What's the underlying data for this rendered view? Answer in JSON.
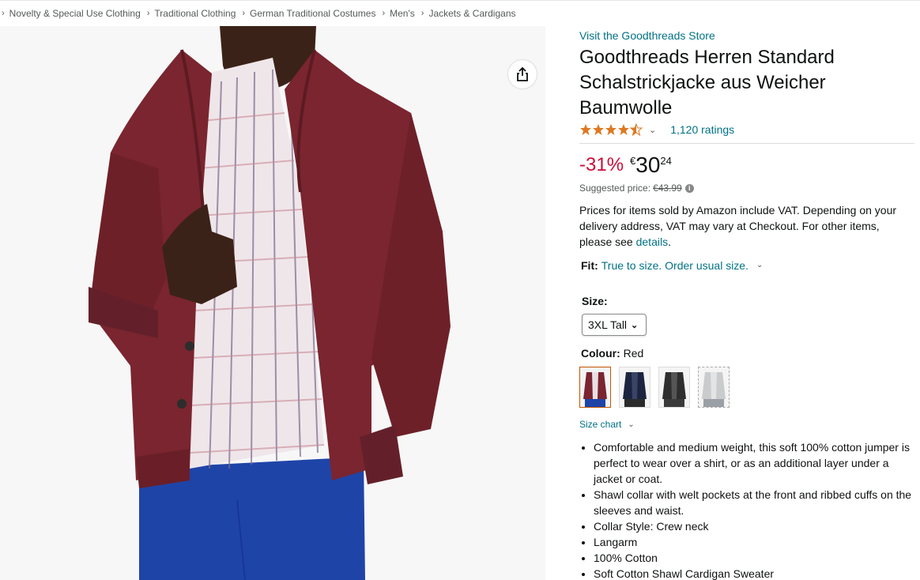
{
  "breadcrumb": {
    "items": [
      "Novelty & Special Use Clothing",
      "Traditional Clothing",
      "German Traditional Costumes",
      "Men's",
      "Jackets & Cardigans"
    ]
  },
  "product": {
    "store_link": "Visit the Goodthreads Store",
    "title": "Goodthreads Herren Standard Schalstrickjacke aus Weicher Baumwolle",
    "rating_value": 4.5,
    "ratings_text": "1,120 ratings",
    "discount": "-31%",
    "currency": "€",
    "price_whole": "30",
    "price_fraction": "24",
    "suggested_label": "Suggested price:",
    "suggested_price": "€43.99",
    "vat_text": "Prices for items sold by Amazon include VAT. Depending on your delivery address, VAT may vary at Checkout. For other items, please see",
    "vat_link": "details",
    "vat_end": ".",
    "fit_label": "Fit:",
    "fit_value": "True to size. Order usual size.",
    "size_label": "Size:",
    "size_selected": "3XL Tall",
    "colour_label": "Colour:",
    "colour_value": "Red",
    "swatches": [
      "Red",
      "Navy",
      "Charcoal",
      "Light Grey"
    ],
    "size_chart": "Size chart",
    "bullets": [
      "Comfortable and medium weight, this soft 100% cotton jumper is perfect to wear over a shirt, or as an additional layer under a jacket or coat.",
      "Shawl collar with welt pockets at the front and ribbed cuffs on the sleeves and waist.",
      "Collar Style: Crew neck",
      "Langarm",
      "100% Cotton",
      "Soft Cotton Shawl Cardigan Sweater"
    ]
  },
  "colors": {
    "link": "#007185",
    "discount": "#cc0c39",
    "star": "#de7921",
    "cardigan": "#7a2530",
    "trousers": "#1f44a8"
  },
  "icons": {
    "share": "share-icon",
    "info": "info-icon"
  }
}
